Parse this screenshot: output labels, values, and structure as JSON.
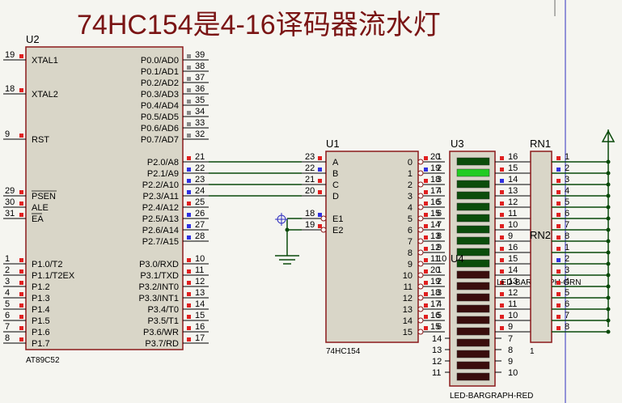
{
  "title": "74HC154是4-16译码器流水灯",
  "colors": {
    "chip_border": "#8b1a1a",
    "chip_fill": "#d9d6c8",
    "wire": "#0a4a0a",
    "title": "#7a1414",
    "led_green_on": "#22cc22",
    "led_green_off": "#0b4d0b",
    "led_red_off": "#3a0d0d",
    "pin_red": "#e02020",
    "pin_blue": "#3030e0",
    "cursor_line": "#3030c0"
  },
  "u2": {
    "ref": "U2",
    "part": "AT89C52",
    "left_pins": [
      {
        "num": "19",
        "name": "XTAL1"
      },
      {
        "num": "18",
        "name": "XTAL2"
      },
      {
        "num": "9",
        "name": "RST"
      },
      {
        "num": "29",
        "name": "PSEN"
      },
      {
        "num": "30",
        "name": "ALE"
      },
      {
        "num": "31",
        "name": "EA"
      },
      {
        "num": "1",
        "name": "P1.0/T2"
      },
      {
        "num": "2",
        "name": "P1.1/T2EX"
      },
      {
        "num": "3",
        "name": "P1.2"
      },
      {
        "num": "4",
        "name": "P1.3"
      },
      {
        "num": "5",
        "name": "P1.4"
      },
      {
        "num": "6",
        "name": "P1.5"
      },
      {
        "num": "7",
        "name": "P1.6"
      },
      {
        "num": "8",
        "name": "P1.7"
      }
    ],
    "right_pins": [
      {
        "num": "39",
        "name": "P0.0/AD0"
      },
      {
        "num": "38",
        "name": "P0.1/AD1"
      },
      {
        "num": "37",
        "name": "P0.2/AD2"
      },
      {
        "num": "36",
        "name": "P0.3/AD3"
      },
      {
        "num": "35",
        "name": "P0.4/AD4"
      },
      {
        "num": "34",
        "name": "P0.5/AD5"
      },
      {
        "num": "33",
        "name": "P0.6/AD6"
      },
      {
        "num": "32",
        "name": "P0.7/AD7"
      },
      {
        "num": "21",
        "name": "P2.0/A8"
      },
      {
        "num": "22",
        "name": "P2.1/A9"
      },
      {
        "num": "23",
        "name": "P2.2/A10"
      },
      {
        "num": "24",
        "name": "P2.3/A11"
      },
      {
        "num": "25",
        "name": "P2.4/A12"
      },
      {
        "num": "26",
        "name": "P2.5/A13"
      },
      {
        "num": "27",
        "name": "P2.6/A14"
      },
      {
        "num": "28",
        "name": "P2.7/A15"
      },
      {
        "num": "10",
        "name": "P3.0/RXD"
      },
      {
        "num": "11",
        "name": "P3.1/TXD"
      },
      {
        "num": "12",
        "name": "P3.2/INT0"
      },
      {
        "num": "13",
        "name": "P3.3/INT1"
      },
      {
        "num": "14",
        "name": "P3.4/T0"
      },
      {
        "num": "15",
        "name": "P3.5/T1"
      },
      {
        "num": "16",
        "name": "P3.6/WR"
      },
      {
        "num": "17",
        "name": "P3.7/RD"
      }
    ]
  },
  "u1": {
    "ref": "U1",
    "part": "74HC154",
    "inputs": [
      {
        "num": "23",
        "name": "A"
      },
      {
        "num": "22",
        "name": "B"
      },
      {
        "num": "21",
        "name": "C"
      },
      {
        "num": "20",
        "name": "D"
      },
      {
        "num": "18",
        "name": "E1"
      },
      {
        "num": "19",
        "name": "E2"
      }
    ],
    "outputs": [
      "0",
      "1",
      "2",
      "3",
      "4",
      "5",
      "6",
      "7",
      "8",
      "9",
      "10",
      "11",
      "12",
      "13",
      "14",
      "15"
    ]
  },
  "u3": {
    "ref": "U3",
    "part": "LED-BARGRAPH-GRN",
    "left_nums": [
      "1",
      "2",
      "3",
      "4",
      "5",
      "6",
      "7",
      "8",
      "9",
      "10"
    ],
    "right_nums": [
      "20",
      "19",
      "18",
      "17",
      "16",
      "15",
      "14",
      "13",
      "12",
      "11"
    ],
    "lit_index": 1
  },
  "u4": {
    "ref": "U4",
    "part": "LED-BARGRAPH-RED",
    "left_nums": [
      "1",
      "2",
      "3",
      "4",
      "5",
      "6",
      "7",
      "8",
      "9",
      "10",
      "14",
      "13",
      "12",
      "11"
    ],
    "right_nums": [
      "20",
      "19",
      "18",
      "17",
      "16",
      "15",
      "14",
      "13",
      "12",
      "11",
      "7",
      "8",
      "9",
      "10"
    ]
  },
  "rn1": {
    "ref": "RN1",
    "left_nums": [
      "16",
      "15",
      "14",
      "13",
      "12",
      "11",
      "10",
      "9"
    ],
    "right_nums": [
      "1",
      "2",
      "3",
      "4",
      "5",
      "6",
      "7",
      "8"
    ]
  },
  "rn2": {
    "ref": "RN2",
    "left_nums": [
      "16",
      "15",
      "14",
      "13",
      "12",
      "11",
      "10",
      "9"
    ],
    "right_nums": [
      "1",
      "2",
      "3",
      "4",
      "5",
      "6",
      "7",
      "8"
    ],
    "bottom_label": "1"
  }
}
